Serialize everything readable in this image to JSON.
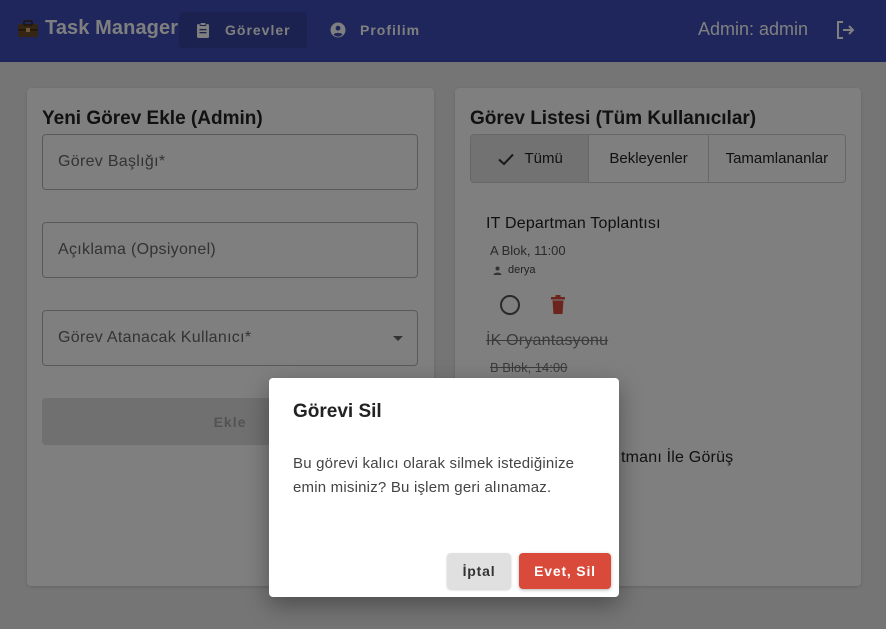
{
  "appbar": {
    "brand": "Task Manager",
    "nav": [
      {
        "label": "Görevler",
        "active": true
      },
      {
        "label": "Profilim",
        "active": false
      }
    ],
    "user_label": "Admin: admin",
    "color": "#3c4db8"
  },
  "add_form": {
    "title": "Yeni Görev Ekle (Admin)",
    "title_placeholder": "Görev Başlığı*",
    "description_placeholder": "Açıklama (Opsiyonel)",
    "assignee_placeholder": "Görev Atanacak Kullanıcı*",
    "submit_label": "Ekle"
  },
  "task_list": {
    "title": "Görev Listesi (Tüm Kullanıcılar)",
    "filters": [
      "Tümü",
      "Bekleyenler",
      "Tamamlananlar"
    ],
    "selected_filter": "Tümü",
    "tasks": [
      {
        "title": "IT Departman Toplantısı",
        "meta": "A Blok, 11:00",
        "user": "derya",
        "done": false
      },
      {
        "title": "İK Oryantasyonu",
        "meta": "B Blok, 14:00",
        "done": true
      },
      {
        "title_partial": "tmanı İle Görüş"
      }
    ]
  },
  "dialog": {
    "title": "Görevi Sil",
    "body": "Bu görevi kalıcı olarak silmek istediğinize emin misiniz? Bu işlem geri alınamaz.",
    "cancel_label": "İptal",
    "confirm_label": "Evet, Sil",
    "confirm_color": "#d94a3a"
  }
}
